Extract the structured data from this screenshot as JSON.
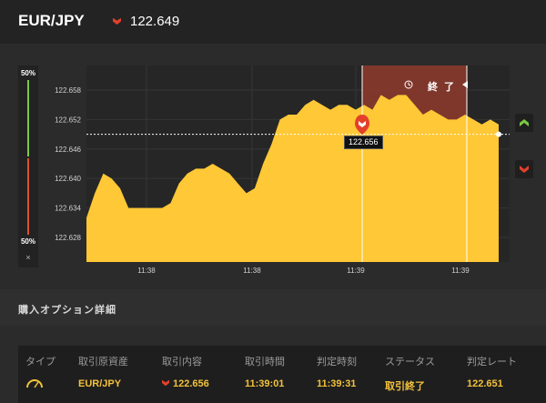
{
  "header": {
    "pair": "EUR/JPY",
    "price": "122.649",
    "direction_icon": "down-arrow-icon",
    "direction_color": "#e2402a"
  },
  "ratio": {
    "top_percent": "50%",
    "bottom_percent": "50%",
    "close_glyph": "×",
    "call_color": "#7ac943",
    "put_color": "#d9532f"
  },
  "chart": {
    "end_label": "終 了",
    "tooltip": "122.656",
    "current_rate": "122.649",
    "ok_color": "#ffc836",
    "expiry_zone_color": "#8a3a2c"
  },
  "chart_data": {
    "type": "area",
    "title": "",
    "xlabel": "",
    "ylabel": "",
    "ylim": [
      122.623,
      122.663
    ],
    "yticks": [
      "122.658",
      "122.652",
      "122.646",
      "122.640",
      "122.634",
      "122.628"
    ],
    "xticks": [
      "11:38",
      "11:38",
      "11:39",
      "11:39"
    ],
    "current_value": 122.649,
    "entry_value": 122.656,
    "series": [
      {
        "values": [
          122.632,
          122.637,
          122.641,
          122.64,
          122.638,
          122.634,
          122.634,
          122.634,
          122.634,
          122.634,
          122.635,
          122.639,
          122.641,
          122.642,
          122.642,
          122.643,
          122.642,
          122.641,
          122.639,
          122.637,
          122.638,
          122.643,
          122.647,
          122.652,
          122.653,
          122.653,
          122.655,
          122.656,
          122.655,
          122.654,
          122.655,
          122.655,
          122.654,
          122.655,
          122.654,
          122.657,
          122.656,
          122.657,
          122.657,
          122.655,
          122.653,
          122.654,
          122.653,
          122.652,
          122.652,
          122.653,
          122.652,
          122.651,
          122.652,
          122.651
        ]
      }
    ]
  },
  "section": {
    "title": "購入オプション詳細"
  },
  "table": {
    "headers": [
      "タイプ",
      "取引原資産",
      "取引内容",
      "取引時間",
      "判定時刻",
      "ステータス",
      "判定レート"
    ],
    "row": {
      "type_icon": "gauge-icon",
      "asset": "EUR/JPY",
      "content": "122.656",
      "content_icon": "down-arrow-icon",
      "trade_time": "11:39:01",
      "judge_time": "11:39:31",
      "status": "取引終了",
      "rate": "122.651"
    }
  }
}
